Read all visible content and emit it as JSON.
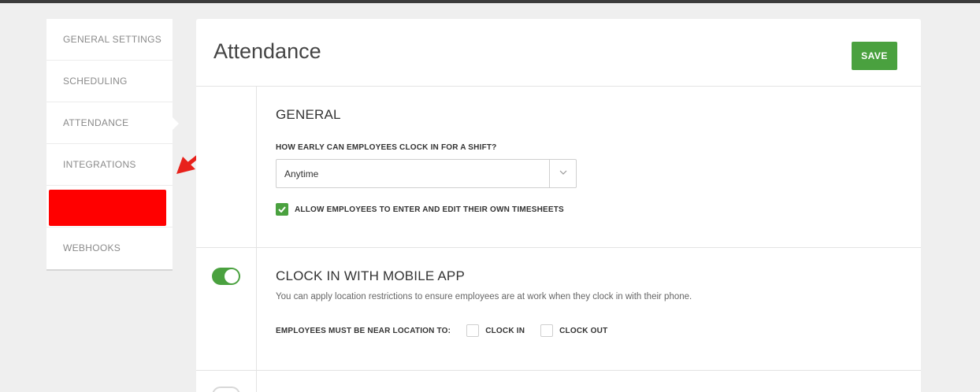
{
  "sidebar": {
    "items": [
      {
        "label": "GENERAL SETTINGS"
      },
      {
        "label": "SCHEDULING"
      },
      {
        "label": "ATTENDANCE"
      },
      {
        "label": "INTEGRATIONS"
      },
      {
        "label": ""
      },
      {
        "label": "WEBHOOKS"
      }
    ],
    "active": "ATTENDANCE"
  },
  "header": {
    "title": "Attendance",
    "save_label": "SAVE"
  },
  "general": {
    "title": "GENERAL",
    "clock_in_question": "HOW EARLY CAN EMPLOYEES CLOCK IN FOR A SHIFT?",
    "clock_in_value": "Anytime",
    "timesheet_label": "ALLOW EMPLOYEES TO ENTER AND EDIT THEIR OWN TIMESHEETS",
    "timesheet_checked": true
  },
  "mobile": {
    "title": "CLOCK IN WITH MOBILE APP",
    "enabled": true,
    "description": "You can apply location restrictions to ensure employees are at work when they clock in with their phone.",
    "location_label": "EMPLOYEES MUST BE NEAR LOCATION TO:",
    "clock_in_label": "CLOCK IN",
    "clock_out_label": "CLOCK OUT"
  },
  "colors": {
    "accent": "#4aa13f",
    "redaction": "#ff0000",
    "annotation_arrow": "#e8211b"
  },
  "icons": [
    "chevron-down-icon",
    "check-icon",
    "arrow-annotation-icon"
  ]
}
